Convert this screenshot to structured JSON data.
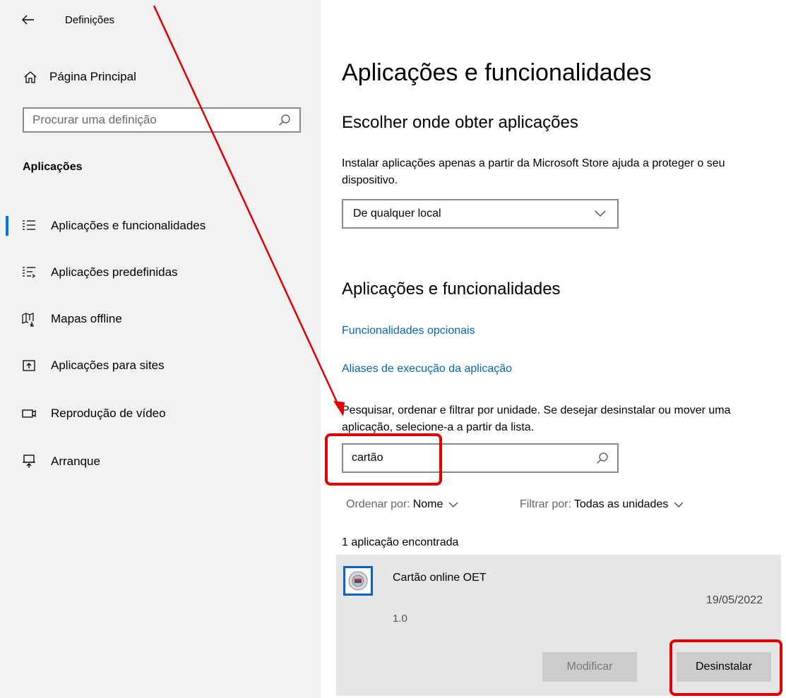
{
  "window": {
    "title": "Definições"
  },
  "sidebar": {
    "home_label": "Página Principal",
    "search_placeholder": "Procurar uma definição",
    "section_label": "Aplicações",
    "items": [
      {
        "label": "Aplicações e funcionalidades",
        "icon": "apps-features-icon",
        "active": true
      },
      {
        "label": "Aplicações predefinidas",
        "icon": "default-apps-icon",
        "active": false
      },
      {
        "label": "Mapas offline",
        "icon": "offline-maps-icon",
        "active": false
      },
      {
        "label": "Aplicações para sites",
        "icon": "apps-for-websites-icon",
        "active": false
      },
      {
        "label": "Reprodução de vídeo",
        "icon": "video-playback-icon",
        "active": false
      },
      {
        "label": "Arranque",
        "icon": "startup-icon",
        "active": false
      }
    ]
  },
  "main": {
    "title": "Aplicações e funcionalidades",
    "choose_heading": "Escolher onde obter aplicações",
    "choose_desc": "Instalar aplicações apenas a partir da Microsoft Store ajuda a proteger o seu dispositivo.",
    "source_select_value": "De qualquer local",
    "apps_heading": "Aplicações e funcionalidades",
    "link_optional": "Funcionalidades opcionais",
    "link_aliases": "Aliases de execução da aplicação",
    "search_desc": "Pesquisar, ordenar e filtrar por unidade. Se desejar desinstalar ou mover uma aplicação, selecione-a a partir da lista.",
    "search_value": "cartão",
    "sort_label": "Ordenar por:",
    "sort_value": "Nome",
    "filter_label": "Filtrar por:",
    "filter_value": "Todas as unidades",
    "result_count": "1 aplicação encontrada",
    "app": {
      "name": "Cartão online OET",
      "date": "19/05/2022",
      "version": "1.0",
      "modify_label": "Modificar",
      "uninstall_label": "Desinstalar"
    }
  },
  "colors": {
    "accent": "#0078d7",
    "link": "#0067b8",
    "annotation": "#e00000",
    "sidebar_bg": "#f2f2f2",
    "card_bg": "#e6e6e6"
  }
}
